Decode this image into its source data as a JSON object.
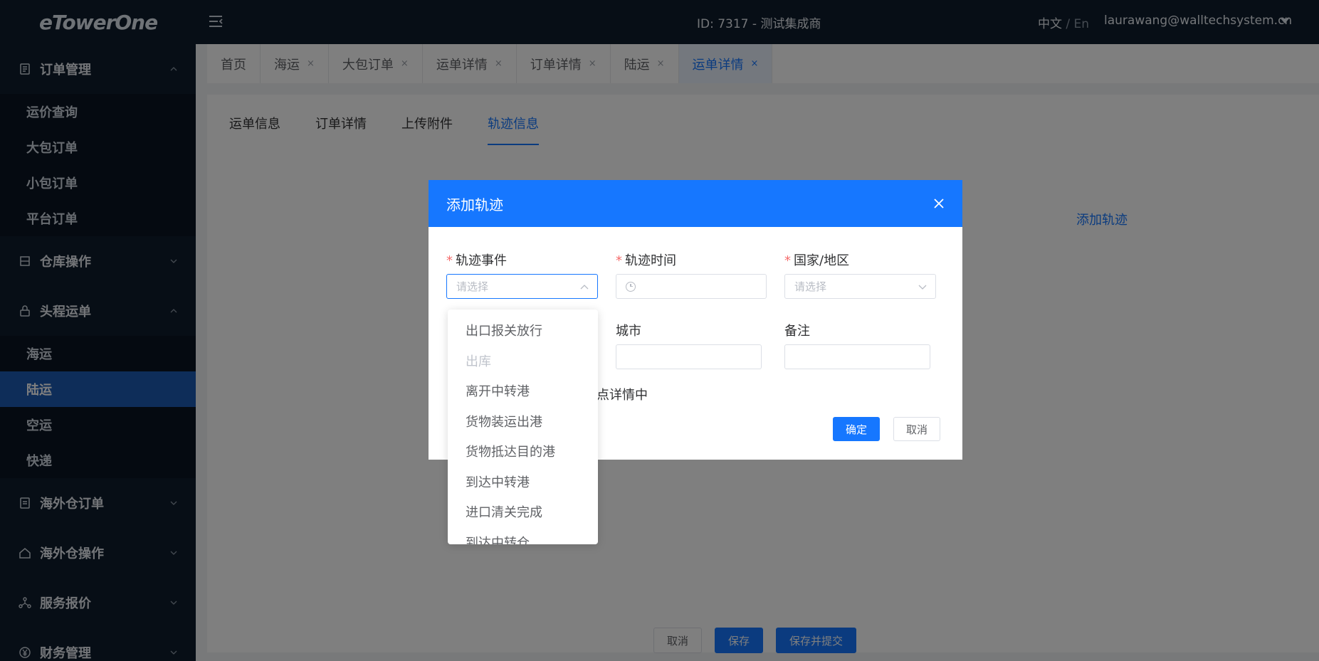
{
  "app": {
    "logo": "eTowerOne"
  },
  "header": {
    "center_text": "ID: 7317 - 测试集成商",
    "lang_zh": "中文",
    "lang_sep": " / ",
    "lang_en": "En",
    "user_email": "laurawang@walltechsystem.cn"
  },
  "sidebar": {
    "groups": [
      {
        "label": "订单管理",
        "icon": "order-icon",
        "expanded": true,
        "items": [
          "运价查询",
          "大包订单",
          "小包订单",
          "平台订单"
        ]
      },
      {
        "label": "仓库操作",
        "icon": "warehouse-icon",
        "expanded": false
      },
      {
        "label": "头程运单",
        "icon": "lock-icon",
        "expanded": true,
        "items": [
          "海运",
          "陆运",
          "空运",
          "快递"
        ],
        "active_item": "陆运"
      },
      {
        "label": "海外仓订单",
        "icon": "document-icon",
        "expanded": false
      },
      {
        "label": "海外仓操作",
        "icon": "house-icon",
        "expanded": false
      },
      {
        "label": "服务报价",
        "icon": "network-icon",
        "expanded": false
      },
      {
        "label": "财务管理",
        "icon": "yen-icon",
        "expanded": false
      }
    ]
  },
  "page_tabs": [
    {
      "label": "首页",
      "closable": false
    },
    {
      "label": "海运",
      "closable": true
    },
    {
      "label": "大包订单",
      "closable": true
    },
    {
      "label": "运单详情",
      "closable": true
    },
    {
      "label": "订单详情",
      "closable": true
    },
    {
      "label": "陆运",
      "closable": true
    },
    {
      "label": "运单详情",
      "closable": true,
      "active": true
    }
  ],
  "tab_close_glyph": "×",
  "inner_tabs": [
    "运单信息",
    "订单详情",
    "上传附件",
    "轨迹信息"
  ],
  "add_track_link": "添加轨迹",
  "bottom_buttons": {
    "cancel": "取消",
    "save": "保存",
    "save_submit": "保存并提交"
  },
  "modal": {
    "title": "添加轨迹",
    "required_mark": "*",
    "fields": {
      "event": {
        "label": "轨迹事件",
        "placeholder": "请选择"
      },
      "time": {
        "label": "轨迹时间"
      },
      "country": {
        "label": "国家/地区",
        "placeholder": "请选择"
      },
      "city": {
        "label": "城市"
      },
      "remark": {
        "label": "备注"
      }
    },
    "note_partial": "点详情中",
    "confirm": "确定",
    "cancel": "取消"
  },
  "dropdown": {
    "options": [
      {
        "label": "出口报关放行",
        "disabled": false
      },
      {
        "label": "出库",
        "disabled": true
      },
      {
        "label": "离开中转港",
        "disabled": false
      },
      {
        "label": "货物装运出港",
        "disabled": false
      },
      {
        "label": "货物抵达目的港",
        "disabled": false
      },
      {
        "label": "到达中转港",
        "disabled": false
      },
      {
        "label": "进口清关完成",
        "disabled": false
      },
      {
        "label": "到达中转仓",
        "disabled": false
      }
    ]
  },
  "colors": {
    "primary": "#1677ff",
    "sidebar_bg": "#0f1c2c",
    "sidebar_active": "#1d5ab3",
    "required": "#f56c6c"
  }
}
